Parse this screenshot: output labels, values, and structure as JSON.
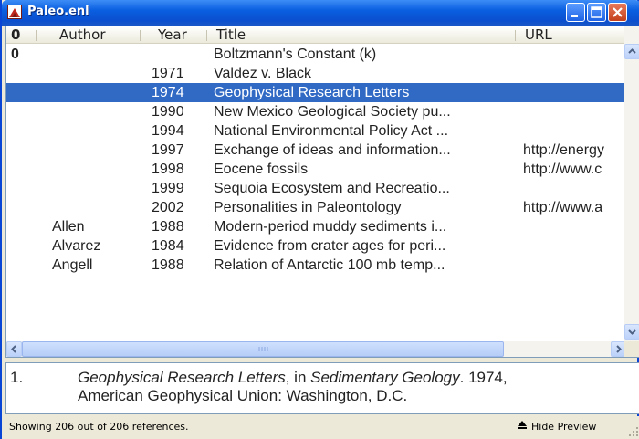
{
  "window": {
    "title": "Paleo.enl"
  },
  "columns": {
    "clip": "0",
    "author": "Author",
    "year": "Year",
    "title": "Title",
    "url": "URL"
  },
  "rows": [
    {
      "clip": "0",
      "author": "",
      "year": "",
      "title": "Boltzmann's Constant (k)",
      "url": ""
    },
    {
      "clip": "",
      "author": "",
      "year": "1971",
      "title": "Valdez v. Black",
      "url": ""
    },
    {
      "clip": "",
      "author": "",
      "year": "1974",
      "title": "Geophysical Research Letters",
      "url": "",
      "selected": true
    },
    {
      "clip": "",
      "author": "",
      "year": "1990",
      "title": "New Mexico Geological Society pu...",
      "url": ""
    },
    {
      "clip": "",
      "author": "",
      "year": "1994",
      "title": "National Environmental Policy Act ...",
      "url": ""
    },
    {
      "clip": "",
      "author": "",
      "year": "1997",
      "title": "Exchange of ideas and information...",
      "url": "http://energy"
    },
    {
      "clip": "",
      "author": "",
      "year": "1998",
      "title": "Eocene fossils",
      "url": "http://www.c"
    },
    {
      "clip": "",
      "author": "",
      "year": "1999",
      "title": "Sequoia Ecosystem and Recreatio...",
      "url": ""
    },
    {
      "clip": "",
      "author": "",
      "year": "2002",
      "title": "Personalities in Paleontology",
      "url": "http://www.a"
    },
    {
      "clip": "",
      "author": "Allen",
      "year": "1988",
      "title": "Modern-period muddy sediments i...",
      "url": ""
    },
    {
      "clip": "",
      "author": "Alvarez",
      "year": "1984",
      "title": "Evidence from crater ages for peri...",
      "url": ""
    },
    {
      "clip": "",
      "author": "Angell",
      "year": "1988",
      "title": "Relation of Antarctic 100 mb temp...",
      "url": ""
    }
  ],
  "preview": {
    "number": "1.",
    "journal": "Geophysical Research Letters",
    "in_word": ", in ",
    "book": "Sedimentary Geology",
    "year_part": ". 1974,",
    "publisher_line": "American Geophysical Union: Washington, D.C."
  },
  "status": {
    "count_text": "Showing 206 out of 206 references.",
    "hide_preview_label": "Hide Preview"
  },
  "colors": {
    "selection": "#316ac5",
    "titlebar": "#0a5fe0"
  }
}
